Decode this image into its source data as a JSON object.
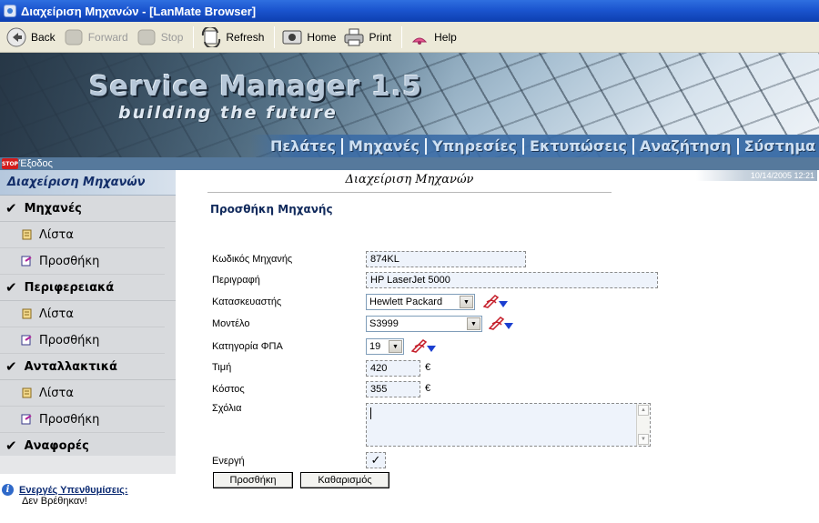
{
  "window": {
    "title": "Διαχείριση Μηχανών - [LanMate Browser]"
  },
  "toolbar": {
    "back": "Back",
    "forward": "Forward",
    "stop": "Stop",
    "refresh": "Refresh",
    "home": "Home",
    "print": "Print",
    "help": "Help"
  },
  "banner": {
    "title": "Service Manager 1.5",
    "subtitle": "building the future",
    "nav": [
      "Πελάτες",
      "Μηχανές",
      "Υπηρεσίες",
      "Εκτυπώσεις",
      "Αναζήτηση",
      "Σύστημα"
    ]
  },
  "exit": {
    "label": "Έξοδος",
    "icon_text": "STOP"
  },
  "datetime": "10/14/2005 12:21",
  "sidebar": {
    "header": "Διαχείριση Μηχανών",
    "sections": [
      {
        "label": "Μηχανές",
        "items": [
          "Λίστα",
          "Προσθήκη"
        ]
      },
      {
        "label": "Περιφερειακά",
        "items": [
          "Λίστα",
          "Προσθήκη"
        ]
      },
      {
        "label": "Ανταλλακτικά",
        "items": [
          "Λίστα",
          "Προσθήκη"
        ]
      },
      {
        "label": "Αναφορές",
        "items": []
      }
    ]
  },
  "alerts": {
    "title": "Ενεργές Υπενθυμίσεις:",
    "empty": "Δεν Βρέθηκαν!"
  },
  "page": {
    "title": "Διαχείριση Μηχανών",
    "section": "Προσθήκη Μηχανής"
  },
  "form": {
    "code": {
      "label": "Κωδικός Μηχανής",
      "value": "874KL"
    },
    "description": {
      "label": "Περιγραφή",
      "value": "HP LaserJet 5000"
    },
    "manufacturer": {
      "label": "Κατασκευαστής",
      "value": "Hewlett Packard"
    },
    "model": {
      "label": "Μοντέλο",
      "value": "S3999"
    },
    "vat": {
      "label": "Κατηγορία ΦΠΑ",
      "value": "19"
    },
    "price": {
      "label": "Τιμή",
      "value": "420",
      "unit": "€"
    },
    "cost": {
      "label": "Κόστος",
      "value": "355",
      "unit": "€"
    },
    "comments": {
      "label": "Σχόλια",
      "value": ""
    },
    "active": {
      "label": "Ενεργή",
      "checked": true
    },
    "submit_label": "Προσθήκη",
    "clear_label": "Καθαρισμός"
  },
  "colors": {
    "titlebar": "#1b55cf",
    "accent": "#142f6a",
    "input_bg": "#eef3fb"
  }
}
